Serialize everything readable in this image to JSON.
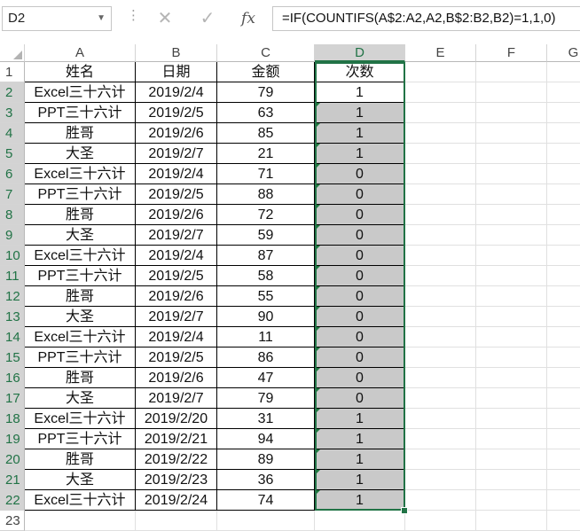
{
  "name_box": {
    "value": "D2"
  },
  "formula_bar": {
    "formula": "=IF(COUNTIFS(A$2:A2,A2,B$2:B2,B2)=1,1,0)"
  },
  "columns": [
    "A",
    "B",
    "C",
    "D",
    "E",
    "F",
    "G"
  ],
  "headers": [
    "姓名",
    "日期",
    "金额",
    "次数"
  ],
  "rows": [
    {
      "n": "1"
    },
    {
      "n": "2",
      "a": "Excel三十六计",
      "b": "2019/2/4",
      "c": "79",
      "d": "1"
    },
    {
      "n": "3",
      "a": "PPT三十六计",
      "b": "2019/2/5",
      "c": "63",
      "d": "1"
    },
    {
      "n": "4",
      "a": "胜哥",
      "b": "2019/2/6",
      "c": "85",
      "d": "1"
    },
    {
      "n": "5",
      "a": "大圣",
      "b": "2019/2/7",
      "c": "21",
      "d": "1"
    },
    {
      "n": "6",
      "a": "Excel三十六计",
      "b": "2019/2/4",
      "c": "71",
      "d": "0"
    },
    {
      "n": "7",
      "a": "PPT三十六计",
      "b": "2019/2/5",
      "c": "88",
      "d": "0"
    },
    {
      "n": "8",
      "a": "胜哥",
      "b": "2019/2/6",
      "c": "72",
      "d": "0"
    },
    {
      "n": "9",
      "a": "大圣",
      "b": "2019/2/7",
      "c": "59",
      "d": "0"
    },
    {
      "n": "10",
      "a": "Excel三十六计",
      "b": "2019/2/4",
      "c": "87",
      "d": "0"
    },
    {
      "n": "11",
      "a": "PPT三十六计",
      "b": "2019/2/5",
      "c": "58",
      "d": "0"
    },
    {
      "n": "12",
      "a": "胜哥",
      "b": "2019/2/6",
      "c": "55",
      "d": "0"
    },
    {
      "n": "13",
      "a": "大圣",
      "b": "2019/2/7",
      "c": "90",
      "d": "0"
    },
    {
      "n": "14",
      "a": "Excel三十六计",
      "b": "2019/2/4",
      "c": "11",
      "d": "0"
    },
    {
      "n": "15",
      "a": "PPT三十六计",
      "b": "2019/2/5",
      "c": "86",
      "d": "0"
    },
    {
      "n": "16",
      "a": "胜哥",
      "b": "2019/2/6",
      "c": "47",
      "d": "0"
    },
    {
      "n": "17",
      "a": "大圣",
      "b": "2019/2/7",
      "c": "79",
      "d": "0"
    },
    {
      "n": "18",
      "a": "Excel三十六计",
      "b": "2019/2/20",
      "c": "31",
      "d": "1"
    },
    {
      "n": "19",
      "a": "PPT三十六计",
      "b": "2019/2/21",
      "c": "94",
      "d": "1"
    },
    {
      "n": "20",
      "a": "胜哥",
      "b": "2019/2/22",
      "c": "89",
      "d": "1"
    },
    {
      "n": "21",
      "a": "大圣",
      "b": "2019/2/23",
      "c": "36",
      "d": "1"
    },
    {
      "n": "22",
      "a": "Excel三十六计",
      "b": "2019/2/24",
      "c": "74",
      "d": "1"
    },
    {
      "n": "23"
    }
  ],
  "colors": {
    "selection": "#217346",
    "selected_fill": "#c9c9c9",
    "error_triangle": "#1f7a3f"
  }
}
